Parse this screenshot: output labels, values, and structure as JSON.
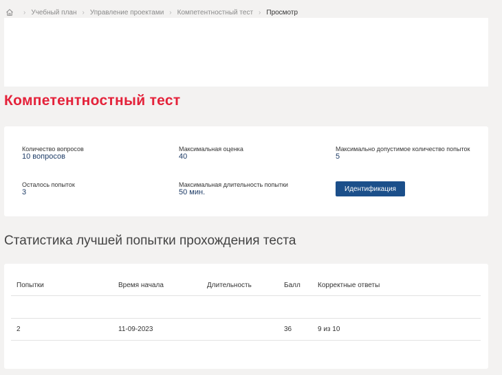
{
  "breadcrumb": {
    "home_icon": "home-icon",
    "items": [
      "Учебный план",
      "Управление проектами",
      "Компетентностный тест"
    ],
    "current": "Просмотр"
  },
  "page": {
    "title": "Компетентностный тест"
  },
  "info": {
    "questions_label": "Количество вопросов",
    "questions_value": "10 вопросов",
    "max_score_label": "Максимальная оценка",
    "max_score_value": "40",
    "max_attempts_label": "Максимально допустимое количество попыток",
    "max_attempts_value": "5",
    "remaining_label": "Осталось попыток",
    "remaining_value": "3",
    "max_duration_label": "Максимальная длительность попытки",
    "max_duration_value": "50 мин.",
    "ident_button": "Идентификация"
  },
  "stats": {
    "heading": "Статистика лучшей попытки прохождения теста",
    "columns": [
      "Попытки",
      "Время начала",
      "Длительность",
      "Балл",
      "Корректные ответы"
    ],
    "rows": [
      [
        "2",
        "11-09-2023",
        "",
        "36",
        "9 из 10"
      ]
    ]
  },
  "colors": {
    "title": "#e4223a",
    "accent": "#1b4f8a",
    "value": "#1d3b66",
    "background": "#f3f2f1"
  }
}
